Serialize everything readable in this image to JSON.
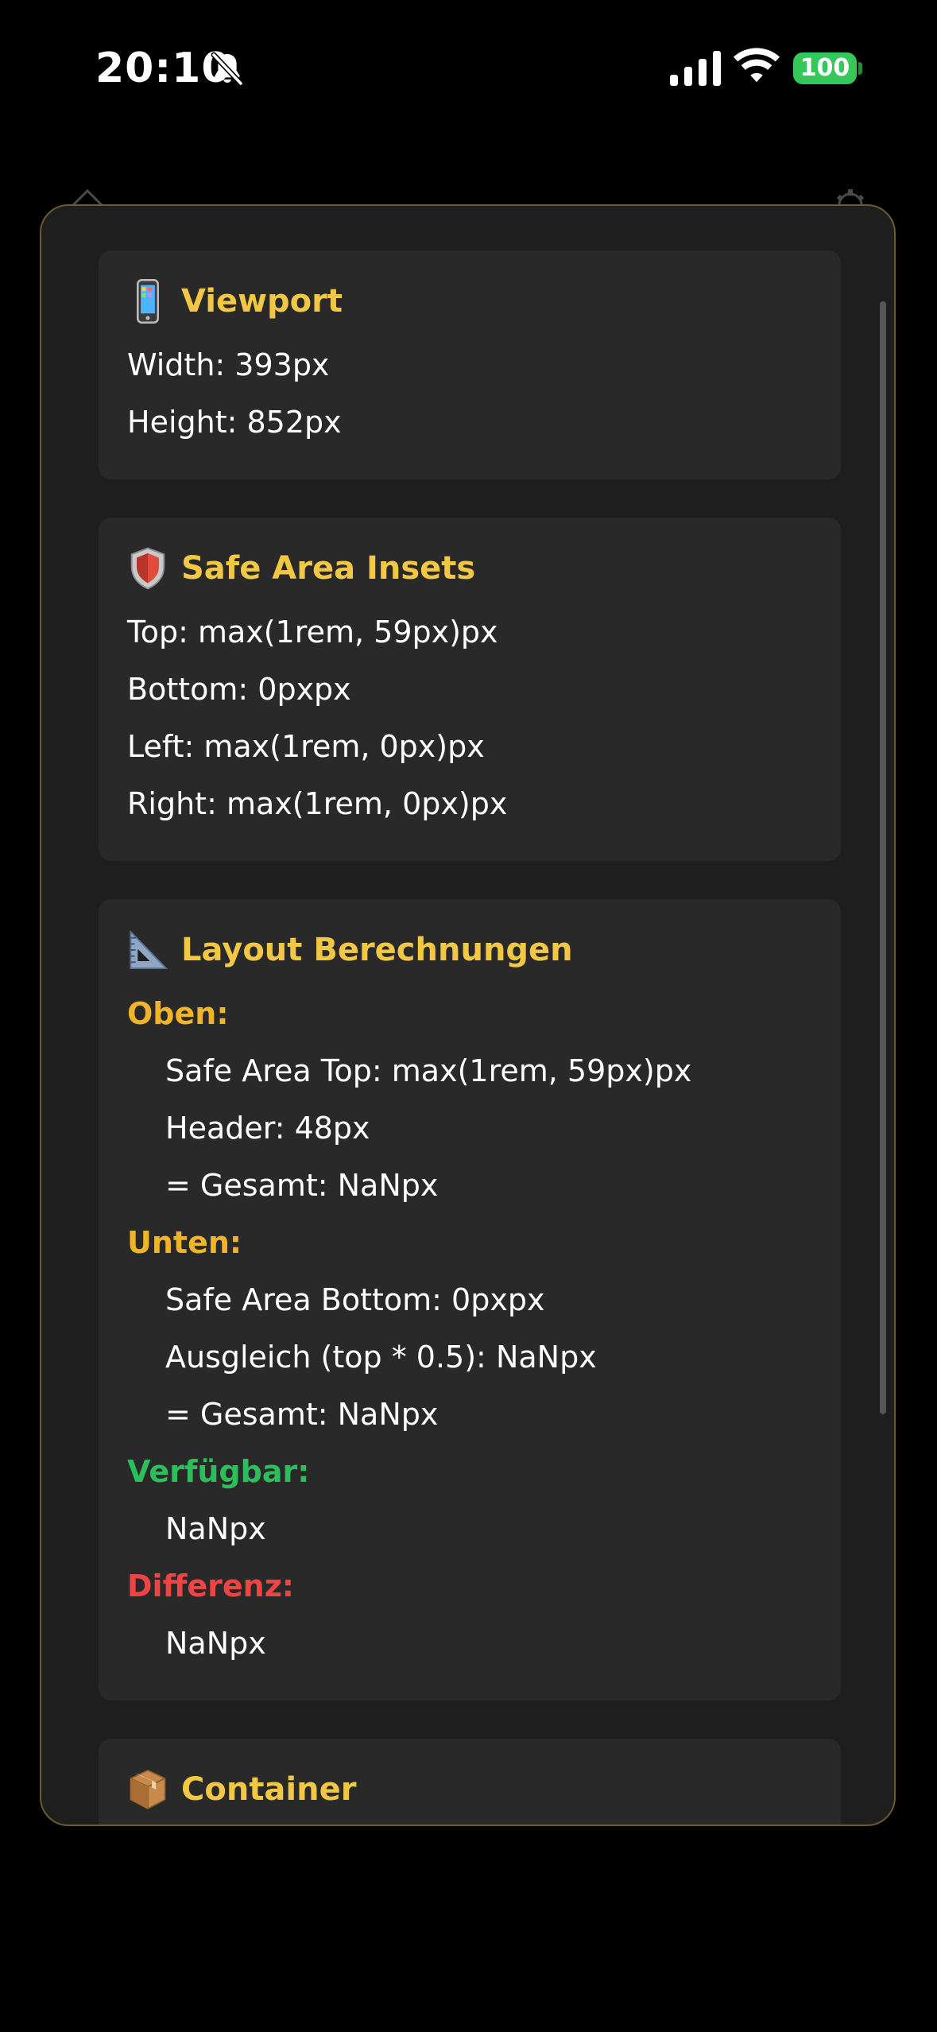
{
  "status_bar": {
    "time": "20:10",
    "battery_level": "100",
    "icons": [
      "bell-slash-icon",
      "cellular-signal-icon",
      "wifi-icon",
      "battery-icon"
    ]
  },
  "background_header": {
    "icons": [
      "home-icon",
      "gear-icon"
    ]
  },
  "debug_panel": {
    "sections": {
      "viewport": {
        "icon": "mobile-phone-icon",
        "title": "Viewport",
        "rows": [
          "Width: 393px",
          "Height: 852px"
        ]
      },
      "safe_area": {
        "icon": "shield-icon",
        "title": "Safe Area Insets",
        "rows": [
          "Top: max(1rem, 59px)px",
          "Bottom: 0pxpx",
          "Left: max(1rem, 0px)px",
          "Right: max(1rem, 0px)px"
        ]
      },
      "layout": {
        "icon": "triangle-ruler-icon",
        "title": "Layout Berechnungen",
        "oben_label": "Oben:",
        "oben_rows": [
          "Safe Area Top: max(1rem, 59px)px",
          "Header: 48px",
          "= Gesamt: NaNpx"
        ],
        "unten_label": "Unten:",
        "unten_rows": [
          "Safe Area Bottom: 0pxpx",
          "Ausgleich (top * 0.5): NaNpx",
          "= Gesamt: NaNpx"
        ],
        "verfuegbar_label": "Verfügbar:",
        "verfuegbar_value": "NaNpx",
        "differenz_label": "Differenz:",
        "differenz_value": "NaNpx"
      },
      "container": {
        "icon": "package-icon",
        "title": "Container"
      }
    }
  },
  "colors": {
    "background": "#000000",
    "panel": "#1e1e1e",
    "card": "#292929",
    "title_yellow": "#f2c744",
    "label_yellow": "#f0b429",
    "green": "#2dbe5c",
    "red": "#ef4444",
    "battery_green": "#34c759"
  }
}
